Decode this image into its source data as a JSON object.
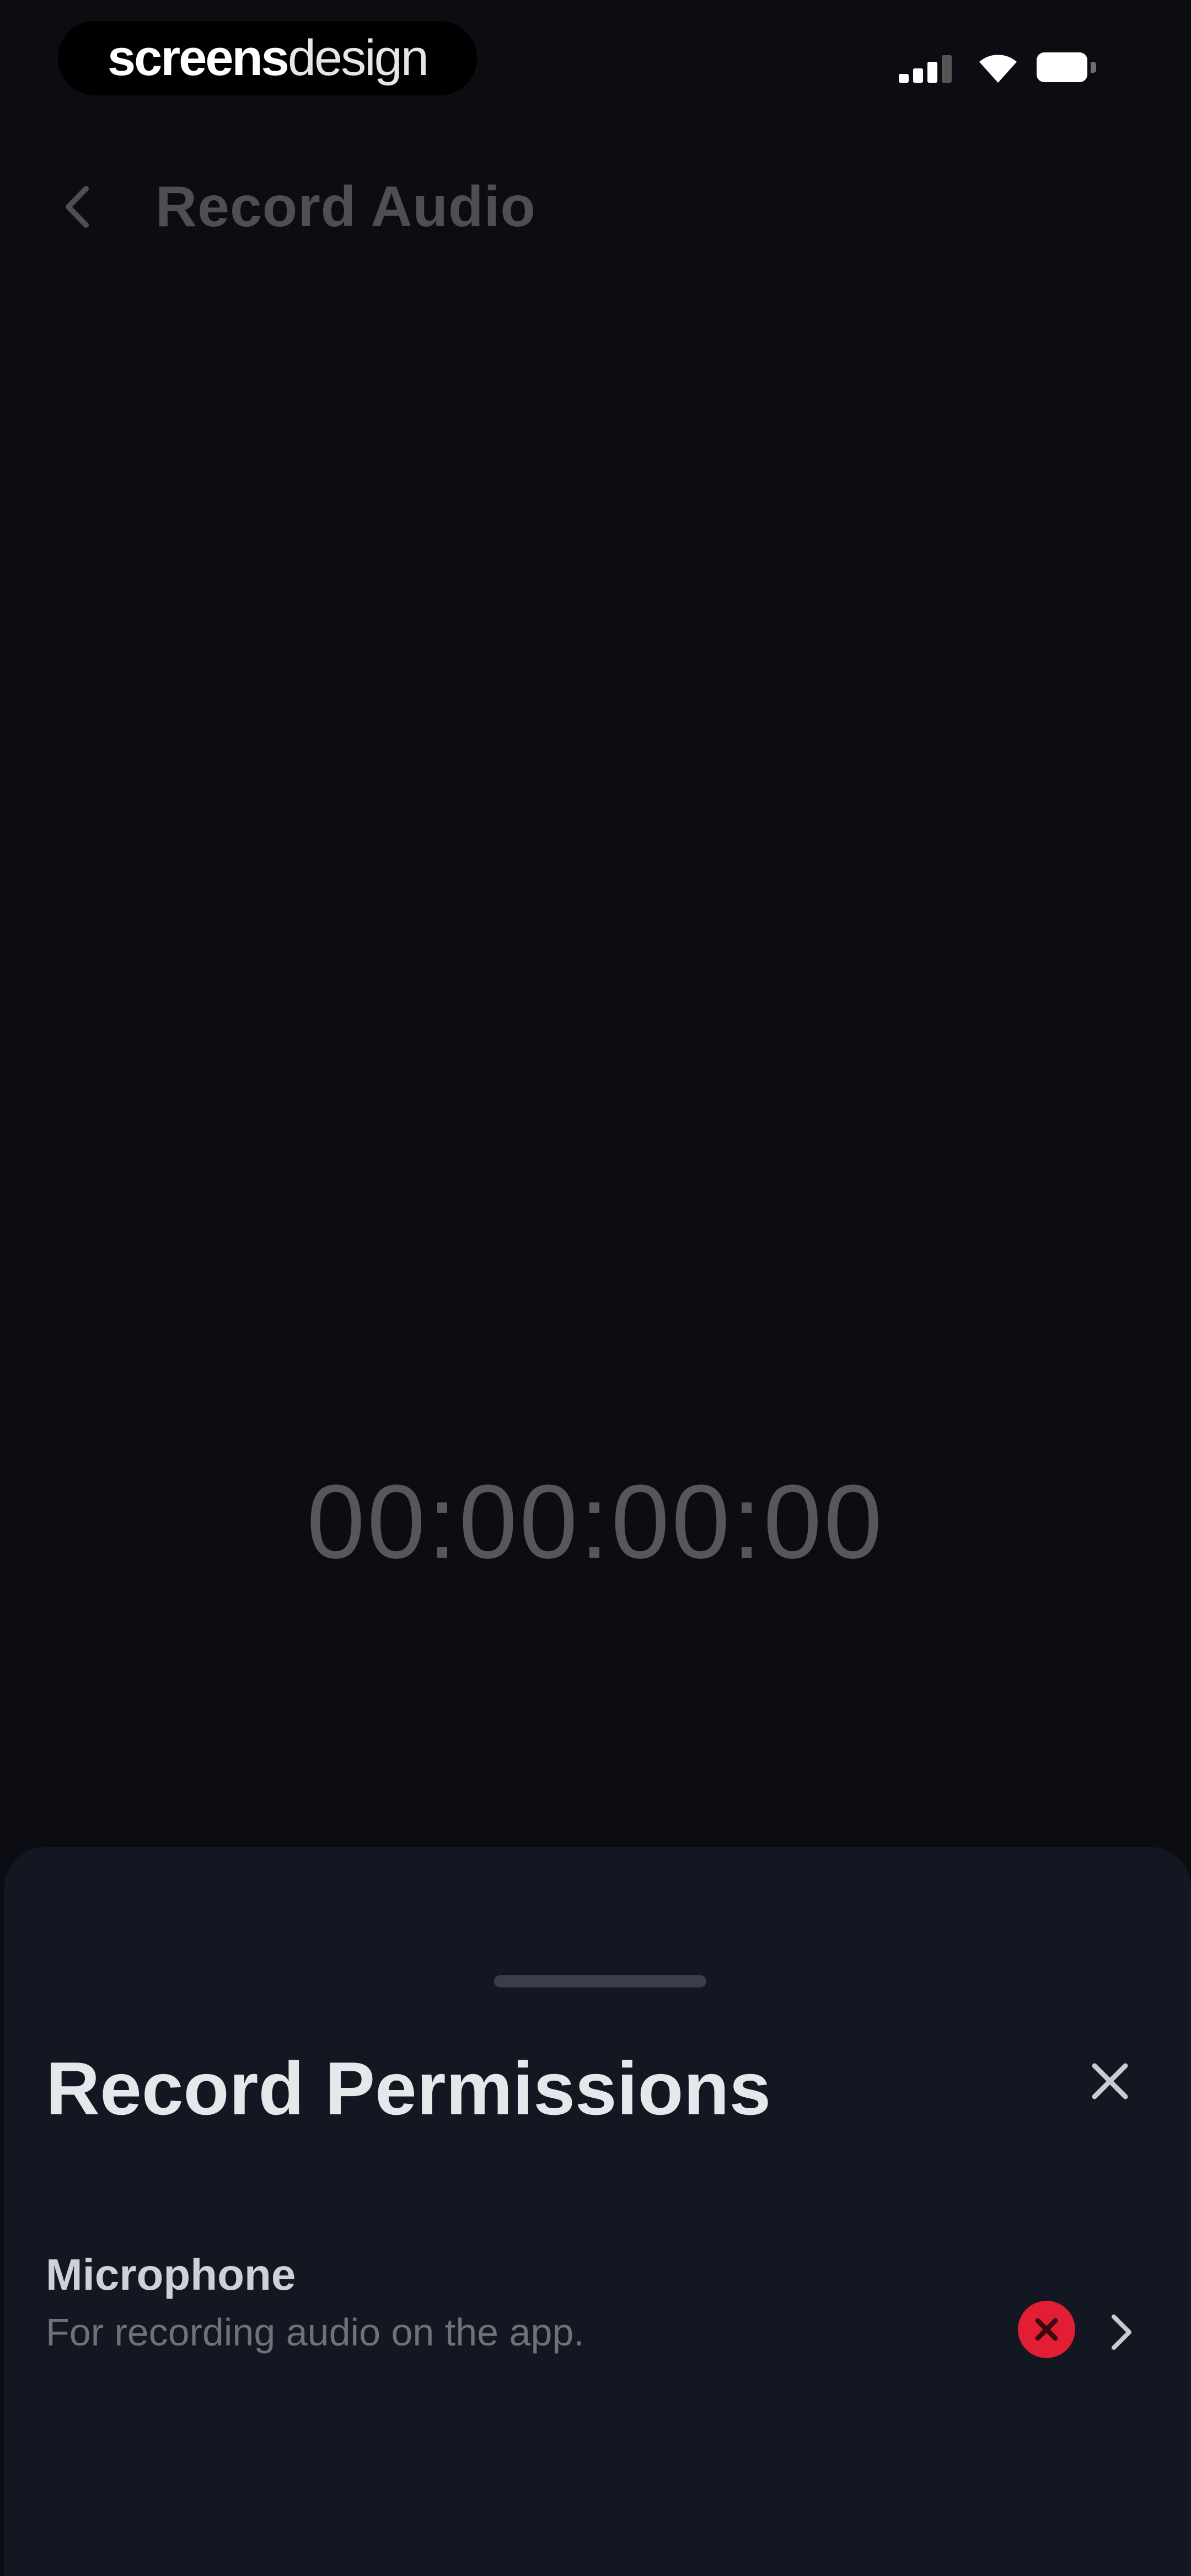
{
  "status_bar": {
    "brand_part1": "screens",
    "brand_part2": "design",
    "icons": [
      "cellular-signal-icon",
      "wifi-icon",
      "battery-icon"
    ]
  },
  "nav": {
    "back_icon": "chevron-left-icon",
    "title": "Record Audio"
  },
  "timer": {
    "value": "00:00:00:00"
  },
  "sheet": {
    "title": "Record Permissions",
    "close_icon": "close-icon",
    "permissions": [
      {
        "name": "Microphone",
        "description": "For recording audio on the app.",
        "status_icon": "denied-x-icon",
        "status_color": "#e21e35",
        "action_icon": "chevron-right-icon"
      }
    ]
  },
  "colors": {
    "background": "#0b0d13",
    "sheet": "#131722",
    "denied": "#e21e35"
  }
}
